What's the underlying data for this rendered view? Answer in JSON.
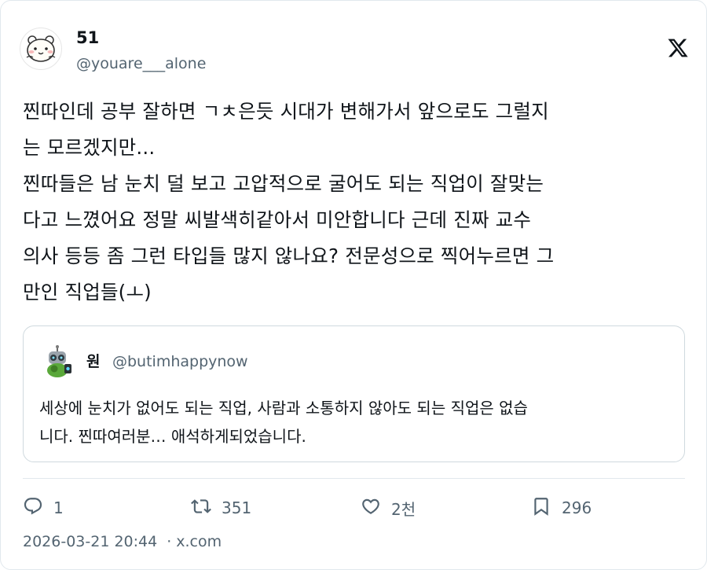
{
  "author": {
    "display_name": "51",
    "handle": "@youare___alone",
    "avatar_icon": "hamster-avatar-icon"
  },
  "platform_logo": "x-logo-icon",
  "tweet": {
    "text": "찐따인데 공부 잘하면 ㄱㅊ은듯 시대가 변해가서 앞으로도 그럴지\n는 모르겠지만...\n찐따들은 남 눈치 덜 보고 고압적으로 굴어도 되는 직업이 잘맞는\n다고 느꼈어요 정말 씨발색히같아서 미안합니다 근데 진짜 교수\n의사 등등 좀 그런 타입들 많지 않나요? 전문성으로 찍어누르면 그\n만인 직업들(ㅗ)"
  },
  "quoted_tweet": {
    "display_name": "원",
    "handle": "@butimhappynow",
    "avatar_icon": "robot-avatar-icon",
    "text": "세상에 눈치가 없어도 되는 직업, 사람과 소통하지 않아도 되는 직업은 없습\n니다. 찐따여러분… 애석하게되었습니다."
  },
  "actions": {
    "reply_count": "1",
    "retweet_count": "351",
    "like_count": "2천",
    "bookmark_count": "296"
  },
  "meta": {
    "timestamp": "2026-03-21 20:44",
    "separator": "·",
    "source": "x.com"
  },
  "colors": {
    "text_primary": "#0f1419",
    "text_secondary": "#536471",
    "border": "#cfd9de"
  }
}
